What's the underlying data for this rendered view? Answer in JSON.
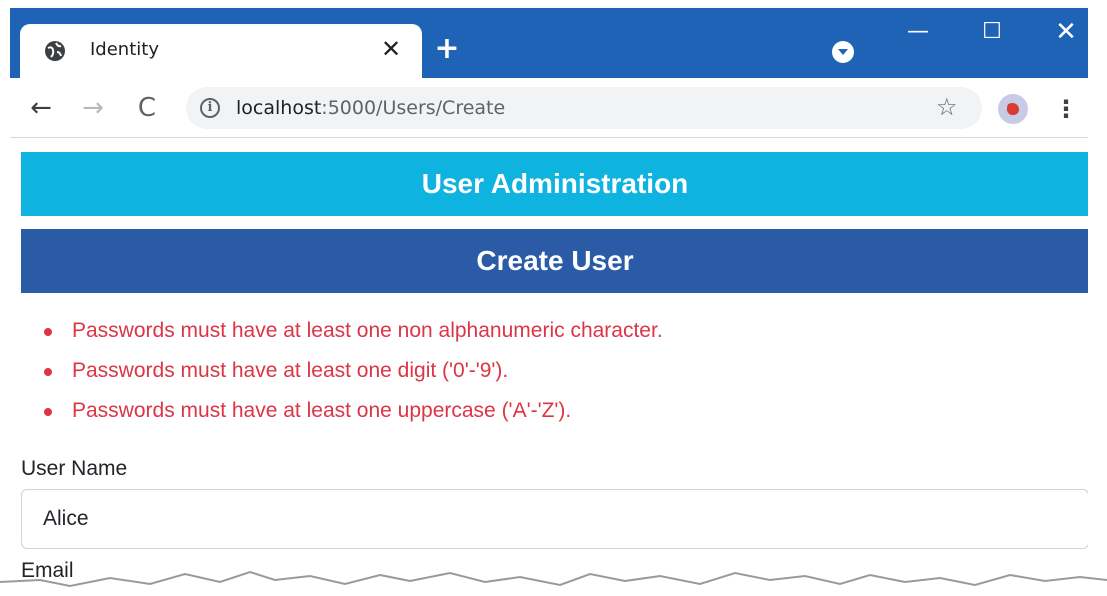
{
  "browser": {
    "tab_title": "Identity",
    "tab_close_glyph": "✕",
    "new_tab_glyph": "+",
    "window_controls": {
      "minimize": "—",
      "maximize": "☐",
      "close": "✕"
    },
    "nav": {
      "back": "←",
      "forward": "→",
      "reload": "C"
    },
    "address_host": "localhost",
    "address_rest": ":5000/Users/Create",
    "info_glyph": "i",
    "bookmark_glyph": "☆",
    "menu_glyph": "⋮",
    "icons": [
      "globe-icon",
      "close-icon",
      "plus-icon",
      "profile-dropdown-icon",
      "minimize-icon",
      "maximize-icon",
      "close-window-icon",
      "back-arrow-icon",
      "forward-arrow-icon",
      "reload-icon",
      "info-icon",
      "star-icon",
      "avatar",
      "kebab-menu-icon"
    ]
  },
  "page": {
    "admin_header": "User Administration",
    "create_header": "Create User",
    "errors": [
      "Passwords must have at least one non alphanumeric character.",
      "Passwords must have at least one digit ('0'-'9').",
      "Passwords must have at least one uppercase ('A'-'Z')."
    ],
    "username_label": "User Name",
    "username_value": "Alice",
    "email_label": "Email"
  },
  "colors": {
    "titlebar": "#1e63b5",
    "admin_banner": "#0fb3e0",
    "create_banner": "#2b5ba7",
    "error_text": "#dc3545"
  }
}
